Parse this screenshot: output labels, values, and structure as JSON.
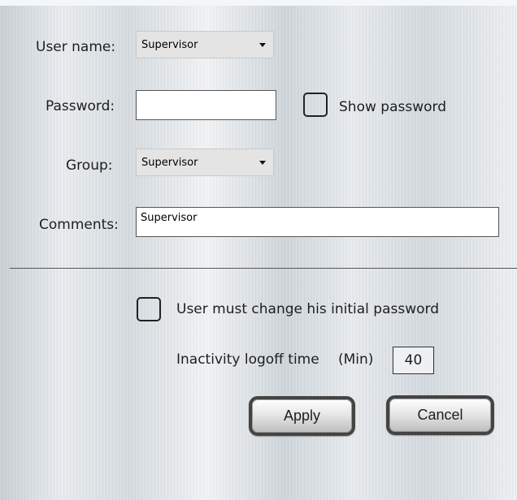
{
  "form": {
    "username_label": "User name:",
    "username_value": "Supervisor",
    "password_label": "Password:",
    "password_value": "",
    "show_password_label": "Show password",
    "group_label": "Group:",
    "group_value": "Supervisor",
    "comments_label": "Comments:",
    "comments_value": "Supervisor"
  },
  "options": {
    "must_change_label": "User must change his initial password",
    "must_change_checked": false,
    "show_password_checked": false,
    "inactivity_label": "Inactivity logoff time",
    "inactivity_unit": "(Min)",
    "inactivity_value": "40"
  },
  "buttons": {
    "apply": "Apply",
    "cancel": "Cancel"
  },
  "icons": {
    "dropdown": "chevron-down-icon",
    "checkbox": "checkbox-icon"
  }
}
